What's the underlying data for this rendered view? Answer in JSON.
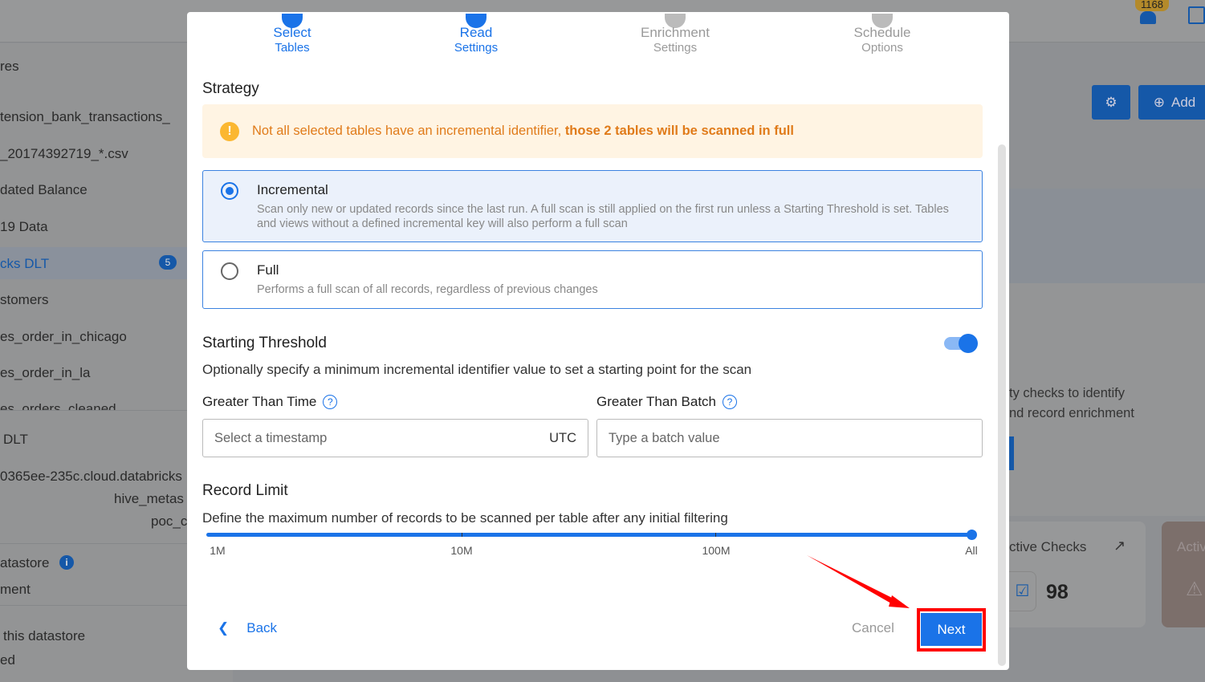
{
  "background": {
    "notification_count": "1168",
    "sidebar_items": [
      "res",
      "tension_bank_transactions_",
      "_20174392719_*.csv",
      "dated Balance",
      "19 Data",
      "cks DLT",
      "stomers",
      "es_order_in_chicago",
      "es_order_in_la",
      "es_orders_cleaned"
    ],
    "sidebar_badge": "5",
    "details": [
      "DLT",
      "0365ee-235c.cloud.databricks",
      "hive_metas",
      "poc_c",
      "atastore",
      "ment",
      "this datastore",
      "ed"
    ],
    "add_label": "Add",
    "panel_text": [
      "ty checks to identify",
      "nd record enrichment"
    ],
    "active_checks_label": "ctive Checks",
    "active_checks_value": "98",
    "anomalies_label": "Activ"
  },
  "steps": [
    {
      "line1": "Select",
      "line2": "Tables",
      "state": "complete"
    },
    {
      "line1": "Read",
      "line2": "Settings",
      "state": "active"
    },
    {
      "line1": "Enrichment",
      "line2": "Settings",
      "state": "pending"
    },
    {
      "line1": "Schedule",
      "line2": "Options",
      "state": "pending"
    }
  ],
  "strategy": {
    "heading": "Strategy",
    "alert_text": "Not all selected tables have an incremental identifier, ",
    "alert_bold": "those 2 tables will be scanned in full",
    "options": [
      {
        "title": "Incremental",
        "description": "Scan only new or updated records since the last run. A full scan is still applied on the first run unless a Starting Threshold is set. Tables and views without a defined incremental key will also perform a full scan",
        "selected": true
      },
      {
        "title": "Full",
        "description": "Performs a full scan of all records, regardless of previous changes",
        "selected": false
      }
    ]
  },
  "threshold": {
    "heading": "Starting Threshold",
    "enabled": true,
    "description": "Optionally specify a minimum incremental identifier value to set a starting point for the scan",
    "time_label": "Greater Than Time",
    "time_placeholder": "Select a timestamp",
    "time_suffix": "UTC",
    "batch_label": "Greater Than Batch",
    "batch_placeholder": "Type a batch value"
  },
  "record_limit": {
    "heading": "Record Limit",
    "description": "Define the maximum number of records to be scanned per table after any initial filtering",
    "ticks": [
      "1M",
      "10M",
      "100M",
      "All"
    ],
    "value": "All"
  },
  "footer": {
    "back": "Back",
    "cancel": "Cancel",
    "next": "Next"
  },
  "colors": {
    "accent": "#1a73e8",
    "warning": "#e07b1a",
    "highlight": "#ff0000"
  }
}
